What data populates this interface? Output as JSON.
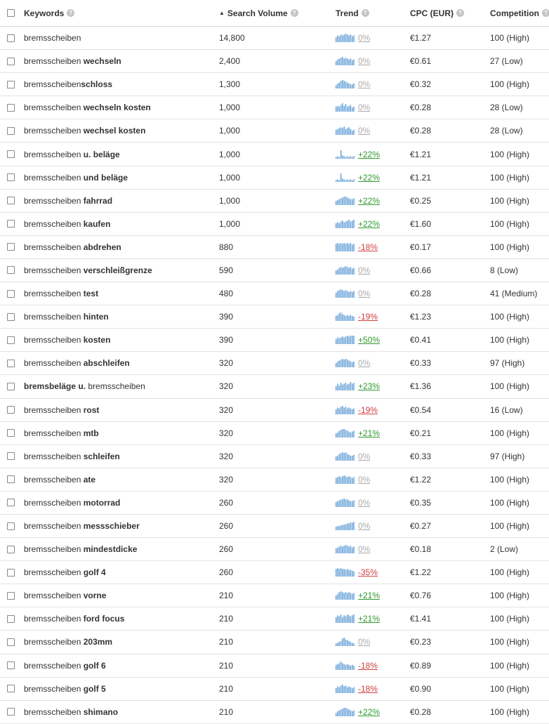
{
  "header": {
    "keywords": "Keywords",
    "volume": "Search Volume",
    "trend": "Trend",
    "cpc": "CPC (EUR)",
    "competition": "Competition",
    "help_glyph": "?",
    "sort_glyph": "▲"
  },
  "rows": [
    {
      "base": "bremsscheiben",
      "mod": "",
      "sep": "",
      "volume": "14,800",
      "trend": "0%",
      "cpc": "€1.27",
      "comp": "100 (High)",
      "spark": [
        6,
        8,
        7,
        9,
        8,
        9,
        10,
        9,
        8,
        9,
        7,
        8
      ]
    },
    {
      "base": "bremsscheiben",
      "mod": "wechseln",
      "sep": " ",
      "volume": "2,400",
      "trend": "0%",
      "cpc": "€0.61",
      "comp": "27 (Low)",
      "spark": [
        5,
        7,
        8,
        9,
        10,
        8,
        9,
        8,
        7,
        8,
        6,
        7
      ]
    },
    {
      "base": "bremsscheiben",
      "mod": "schloss",
      "sep": "",
      "volume": "1,300",
      "trend": "0%",
      "cpc": "€0.32",
      "comp": "100 (High)",
      "spark": [
        4,
        6,
        7,
        9,
        10,
        9,
        8,
        7,
        6,
        5,
        5,
        6
      ]
    },
    {
      "base": "bremsscheiben",
      "mod": "wechseln kosten",
      "sep": " ",
      "volume": "1,000",
      "trend": "0%",
      "cpc": "€0.28",
      "comp": "28 (Low)",
      "spark": [
        6,
        7,
        6,
        8,
        10,
        7,
        9,
        6,
        7,
        8,
        5,
        6
      ]
    },
    {
      "base": "bremsscheiben",
      "mod": "wechsel kosten",
      "sep": " ",
      "volume": "1,000",
      "trend": "0%",
      "cpc": "€0.28",
      "comp": "28 (Low)",
      "spark": [
        6,
        7,
        8,
        9,
        8,
        10,
        7,
        8,
        9,
        7,
        5,
        6
      ]
    },
    {
      "base": "bremsscheiben",
      "mod": "u. beläge",
      "sep": " ",
      "volume": "1,000",
      "trend": "+22%",
      "cpc": "€1.21",
      "comp": "100 (High)",
      "spark": [
        2,
        3,
        2,
        10,
        4,
        3,
        2,
        3,
        2,
        3,
        2,
        3
      ]
    },
    {
      "base": "bremsscheiben",
      "mod": "und beläge",
      "sep": " ",
      "volume": "1,000",
      "trend": "+22%",
      "cpc": "€1.21",
      "comp": "100 (High)",
      "spark": [
        2,
        3,
        2,
        10,
        4,
        3,
        2,
        3,
        2,
        3,
        2,
        3
      ]
    },
    {
      "base": "bremsscheiben",
      "mod": "fahrrad",
      "sep": " ",
      "volume": "1,000",
      "trend": "+22%",
      "cpc": "€0.25",
      "comp": "100 (High)",
      "spark": [
        5,
        6,
        7,
        8,
        9,
        10,
        10,
        9,
        8,
        7,
        7,
        8
      ]
    },
    {
      "base": "bremsscheiben",
      "mod": "kaufen",
      "sep": " ",
      "volume": "1,000",
      "trend": "+22%",
      "cpc": "€1.60",
      "comp": "100 (High)",
      "spark": [
        6,
        7,
        6,
        8,
        9,
        7,
        8,
        9,
        10,
        8,
        9,
        10
      ]
    },
    {
      "base": "bremsscheiben",
      "mod": "abdrehen",
      "sep": " ",
      "volume": "880",
      "trend": "-18%",
      "cpc": "€0.17",
      "comp": "100 (High)",
      "spark": [
        9,
        10,
        9,
        10,
        9,
        10,
        9,
        10,
        9,
        10,
        8,
        9
      ]
    },
    {
      "base": "bremsscheiben",
      "mod": "verschleißgrenze",
      "sep": " ",
      "volume": "590",
      "trend": "0%",
      "cpc": "€0.66",
      "comp": "8 (Low)",
      "spark": [
        5,
        6,
        8,
        9,
        8,
        9,
        10,
        9,
        8,
        9,
        7,
        8
      ]
    },
    {
      "base": "bremsscheiben",
      "mod": "test",
      "sep": " ",
      "volume": "480",
      "trend": "0%",
      "cpc": "€0.28",
      "comp": "41 (Medium)",
      "spark": [
        6,
        8,
        9,
        10,
        9,
        8,
        9,
        8,
        7,
        8,
        7,
        8
      ]
    },
    {
      "base": "bremsscheiben",
      "mod": "hinten",
      "sep": " ",
      "volume": "390",
      "trend": "-19%",
      "cpc": "€1.23",
      "comp": "100 (High)",
      "spark": [
        6,
        7,
        9,
        10,
        8,
        7,
        6,
        7,
        6,
        7,
        6,
        5
      ]
    },
    {
      "base": "bremsscheiben",
      "mod": "kosten",
      "sep": " ",
      "volume": "390",
      "trend": "+50%",
      "cpc": "€0.41",
      "comp": "100 (High)",
      "spark": [
        6,
        8,
        7,
        8,
        9,
        8,
        9,
        10,
        9,
        10,
        10,
        10
      ]
    },
    {
      "base": "bremsscheiben",
      "mod": "abschleifen",
      "sep": " ",
      "volume": "320",
      "trend": "0%",
      "cpc": "€0.33",
      "comp": "97 (High)",
      "spark": [
        5,
        7,
        8,
        9,
        10,
        9,
        10,
        9,
        8,
        7,
        6,
        7
      ]
    },
    {
      "base": "bremsbeläge u.",
      "mod": "",
      "sep": " ",
      "lead": "bremsbeläge u.",
      "tail": "bremsscheiben",
      "volume": "320",
      "trend": "+23%",
      "cpc": "€1.36",
      "comp": "100 (High)",
      "spark": [
        5,
        8,
        6,
        9,
        7,
        8,
        9,
        7,
        8,
        10,
        8,
        9
      ]
    },
    {
      "base": "bremsscheiben",
      "mod": "rost",
      "sep": " ",
      "volume": "320",
      "trend": "-19%",
      "cpc": "€0.54",
      "comp": "16 (Low)",
      "spark": [
        6,
        8,
        7,
        9,
        10,
        8,
        9,
        7,
        8,
        7,
        6,
        7
      ]
    },
    {
      "base": "bremsscheiben",
      "mod": "mtb",
      "sep": " ",
      "volume": "320",
      "trend": "+21%",
      "cpc": "€0.21",
      "comp": "100 (High)",
      "spark": [
        5,
        6,
        8,
        9,
        10,
        10,
        9,
        8,
        7,
        6,
        7,
        8
      ]
    },
    {
      "base": "bremsscheiben",
      "mod": "schleifen",
      "sep": " ",
      "volume": "320",
      "trend": "0%",
      "cpc": "€0.33",
      "comp": "97 (High)",
      "spark": [
        5,
        6,
        8,
        9,
        10,
        9,
        10,
        8,
        7,
        6,
        6,
        7
      ]
    },
    {
      "base": "bremsscheiben",
      "mod": "ate",
      "sep": " ",
      "volume": "320",
      "trend": "0%",
      "cpc": "€1.22",
      "comp": "100 (High)",
      "spark": [
        7,
        8,
        9,
        8,
        9,
        10,
        9,
        8,
        9,
        8,
        7,
        8
      ]
    },
    {
      "base": "bremsscheiben",
      "mod": "motorrad",
      "sep": " ",
      "volume": "260",
      "trend": "0%",
      "cpc": "€0.35",
      "comp": "100 (High)",
      "spark": [
        6,
        7,
        8,
        9,
        9,
        10,
        9,
        9,
        8,
        7,
        7,
        8
      ]
    },
    {
      "base": "bremsscheiben",
      "mod": "messschieber",
      "sep": " ",
      "volume": "260",
      "trend": "0%",
      "cpc": "€0.27",
      "comp": "100 (High)",
      "spark": [
        4,
        5,
        5,
        6,
        6,
        7,
        7,
        8,
        8,
        9,
        9,
        10
      ]
    },
    {
      "base": "bremsscheiben",
      "mod": "mindestdicke",
      "sep": " ",
      "volume": "260",
      "trend": "0%",
      "cpc": "€0.18",
      "comp": "2 (Low)",
      "spark": [
        6,
        7,
        8,
        9,
        8,
        9,
        10,
        9,
        8,
        9,
        7,
        8
      ]
    },
    {
      "base": "bremsscheiben",
      "mod": "golf 4",
      "sep": " ",
      "volume": "260",
      "trend": "-35%",
      "cpc": "€1.22",
      "comp": "100 (High)",
      "spark": [
        9,
        10,
        9,
        10,
        9,
        9,
        8,
        9,
        8,
        8,
        7,
        6
      ]
    },
    {
      "base": "bremsscheiben",
      "mod": "vorne",
      "sep": " ",
      "volume": "210",
      "trend": "+21%",
      "cpc": "€0.76",
      "comp": "100 (High)",
      "spark": [
        5,
        7,
        9,
        10,
        9,
        8,
        9,
        8,
        9,
        8,
        7,
        8
      ]
    },
    {
      "base": "bremsscheiben",
      "mod": "ford focus",
      "sep": " ",
      "volume": "210",
      "trend": "+21%",
      "cpc": "€1.41",
      "comp": "100 (High)",
      "spark": [
        6,
        8,
        7,
        9,
        6,
        8,
        7,
        9,
        8,
        7,
        8,
        9
      ]
    },
    {
      "base": "bremsscheiben",
      "mod": "203mm",
      "sep": " ",
      "volume": "210",
      "trend": "0%",
      "cpc": "€0.23",
      "comp": "100 (High)",
      "spark": [
        3,
        4,
        5,
        6,
        9,
        10,
        8,
        7,
        6,
        5,
        4,
        3
      ]
    },
    {
      "base": "bremsscheiben",
      "mod": "golf 6",
      "sep": " ",
      "volume": "210",
      "trend": "-18%",
      "cpc": "€0.89",
      "comp": "100 (High)",
      "spark": [
        6,
        7,
        8,
        10,
        8,
        7,
        6,
        7,
        6,
        5,
        6,
        5
      ]
    },
    {
      "base": "bremsscheiben",
      "mod": "golf 5",
      "sep": " ",
      "volume": "210",
      "trend": "-18%",
      "cpc": "€0.90",
      "comp": "100 (High)",
      "spark": [
        6,
        8,
        7,
        9,
        10,
        8,
        9,
        7,
        8,
        7,
        6,
        7
      ]
    },
    {
      "base": "bremsscheiben",
      "mod": "shimano",
      "sep": " ",
      "volume": "210",
      "trend": "+22%",
      "cpc": "€0.28",
      "comp": "100 (High)",
      "spark": [
        4,
        6,
        7,
        8,
        9,
        10,
        10,
        9,
        8,
        7,
        6,
        7
      ]
    }
  ]
}
